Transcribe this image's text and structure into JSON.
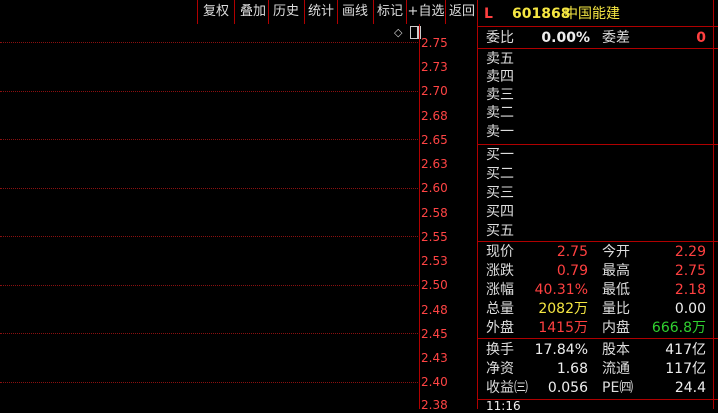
{
  "toolbar": {
    "buttons": [
      "复权",
      "叠加",
      "历史",
      "统计",
      "画线",
      "标记",
      "+自选",
      "返回"
    ]
  },
  "chart": {
    "price_labels": [
      "2.75",
      "2.73",
      "2.70",
      "2.68",
      "2.65",
      "2.63",
      "2.60",
      "2.58",
      "2.55",
      "2.53",
      "2.50",
      "2.48",
      "2.45",
      "2.43",
      "2.40",
      "2.38"
    ],
    "small_icon": "◇"
  },
  "quote": {
    "market_tag": "L",
    "code": "601868",
    "name": "中国能建",
    "wei_bi_label": "委比",
    "wei_bi": "0.00%",
    "wei_cha_label": "委差",
    "wei_cha": "0",
    "sell_labels": [
      "卖五",
      "卖四",
      "卖三",
      "卖二",
      "卖一"
    ],
    "buy_labels": [
      "买一",
      "买二",
      "买三",
      "买四",
      "买五"
    ],
    "stats": {
      "xianjia_label": "现价",
      "xianjia": "2.75",
      "jinkai_label": "今开",
      "jinkai": "2.29",
      "zhangdie_label": "涨跌",
      "zhangdie": "0.79",
      "zuigao_label": "最高",
      "zuigao": "2.75",
      "zhangfu_label": "涨幅",
      "zhangfu": "40.31%",
      "zuidi_label": "最低",
      "zuidi": "2.18",
      "zongliang_label": "总量",
      "zongliang": "2082万",
      "liangbi_label": "量比",
      "liangbi": "0.00",
      "waipan_label": "外盘",
      "waipan": "1415万",
      "neipan_label": "内盘",
      "neipan": "666.8万"
    },
    "fundamentals": {
      "huanshou_label": "换手",
      "huanshou": "17.84%",
      "guben_label": "股本",
      "guben": "417亿",
      "jingzi_label": "净资",
      "jingzi": "1.68",
      "liutong_label": "流通",
      "liutong": "117亿",
      "shouyi_label": "收益㈢",
      "shouyi": "0.056",
      "pe_label": "PE㈣",
      "pe": "24.4"
    },
    "tick_time": "11:16"
  },
  "colors": {
    "border": "#b00000",
    "up": "#ff4040",
    "volume": "#f5e642",
    "down": "#30d030"
  }
}
